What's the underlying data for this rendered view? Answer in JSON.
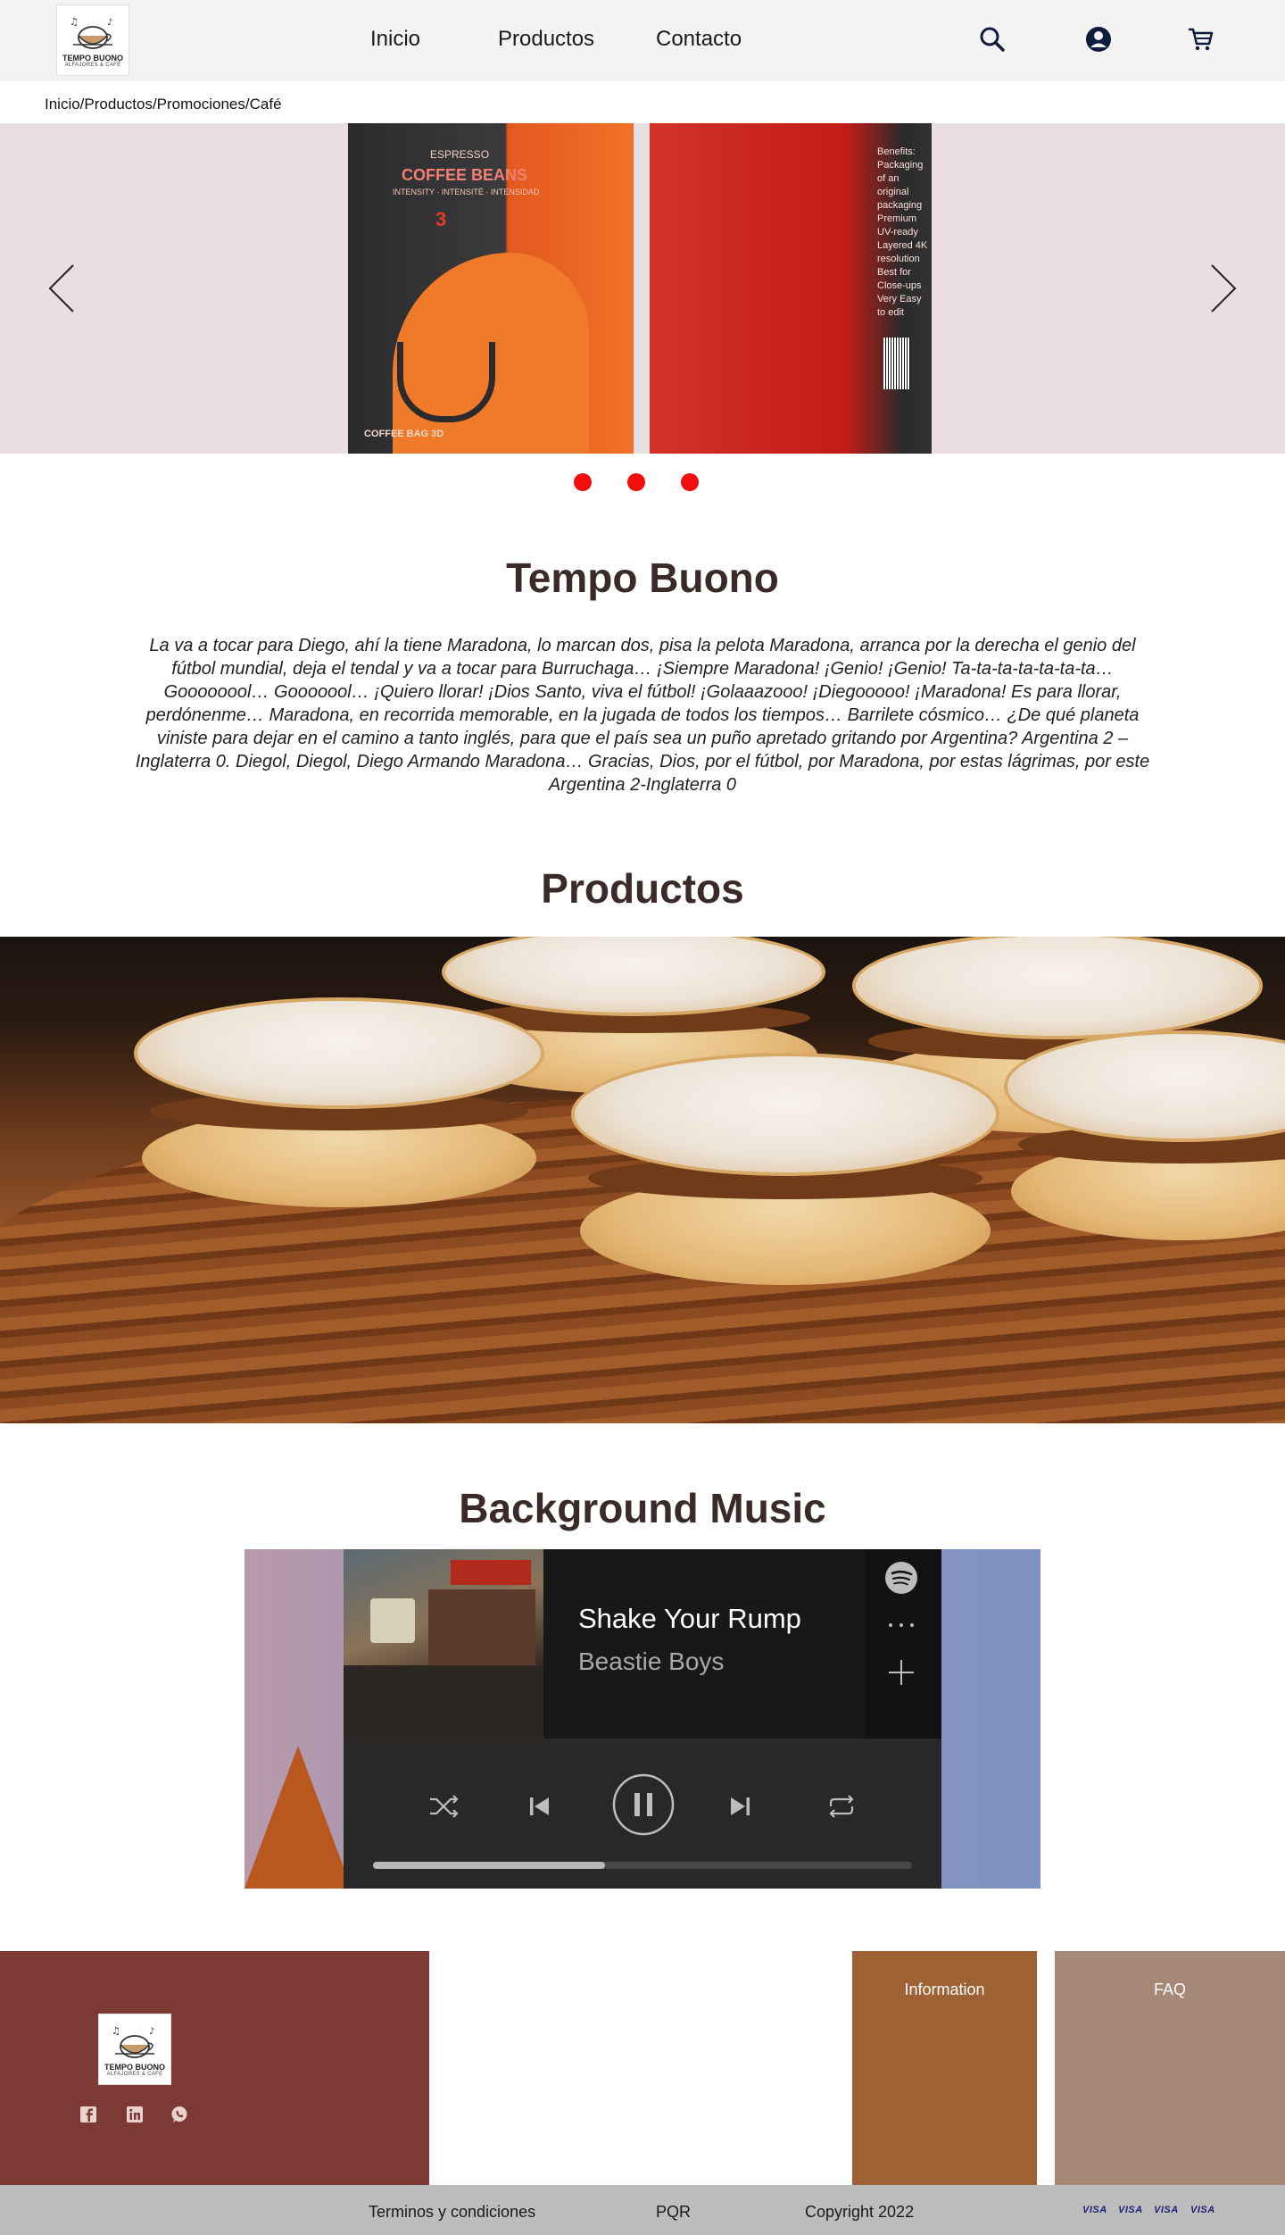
{
  "brand": {
    "logo_name": "TEMPO BUONO",
    "logo_sub": "ALFAJORES & CAFÉ",
    "logo_icon": "coffee-cup-music-notes-icon"
  },
  "nav": {
    "items": [
      "Inicio",
      "Productos",
      "Contacto"
    ],
    "icons": [
      "search-icon",
      "user-icon",
      "cart-icon"
    ]
  },
  "breadcrumb": "Inicio/Productos/Promociones/Café",
  "carousel": {
    "left_bag_title": "COFFEE BEANS",
    "left_bag_pre": "ESPRESSO",
    "left_bag_sub": "INTENSITY · INTENSITÉ · INTENSIDAD",
    "left_bag_number": "3",
    "left_bag_foot": "COFFEE BAG 3D",
    "right_bag_text": "Benefits: Packaging of an original packaging Premium UV-ready Layered 4K resolution Best for Close-ups Very Easy to edit",
    "dots": 3,
    "active_dot": 1,
    "dot_color": "#f30e0e"
  },
  "intro": {
    "title": "Tempo Buono",
    "text": "La va a tocar para Diego, ahí la tiene Maradona, lo marcan dos, pisa la pelota Maradona, arranca por la derecha el genio del fútbol mundial, deja el tendal y va a tocar para Burruchaga… ¡Siempre Maradona! ¡Genio! ¡Genio! Ta-ta-ta-ta-ta-ta-ta… Goooooool… Gooooool… ¡Quiero llorar! ¡Dios Santo, viva el fútbol! ¡Golaaazooo! ¡Diegooooo! ¡Maradona! Es para llorar, perdónenme… Maradona, en recorrida memorable, en la jugada de todos los tiempos… Barrilete cósmico… ¿De qué planeta viniste para dejar en el camino a tanto inglés, para que el país sea un puño apretado gritando por Argentina? Argentina 2 – Inglaterra 0. Diegol, Diegol, Diego Armando Maradona… Gracias, Dios, por el fútbol, por Maradona, por estas lágrimas, por este Argentina 2-Inglaterra 0"
  },
  "products": {
    "title": "Productos"
  },
  "music": {
    "title": "Background Music",
    "song": "Shake Your Rump",
    "artist": "Beastie Boys",
    "progress": 0.43,
    "state": "playing"
  },
  "footer": {
    "information": "Information",
    "faq": "FAQ",
    "social": [
      "facebook-icon",
      "linkedin-icon",
      "whatsapp-icon"
    ],
    "colors": {
      "left": "#7d3a35",
      "info": "#9f6234",
      "faq": "#a78775",
      "bar": "#bdbdbd"
    }
  },
  "bottom": {
    "terms": "Terminos y condiciones",
    "pqr": "PQR",
    "copyright": "Copyright 2022",
    "cards": [
      "VISA",
      "VISA",
      "VISA",
      "VISA"
    ]
  }
}
